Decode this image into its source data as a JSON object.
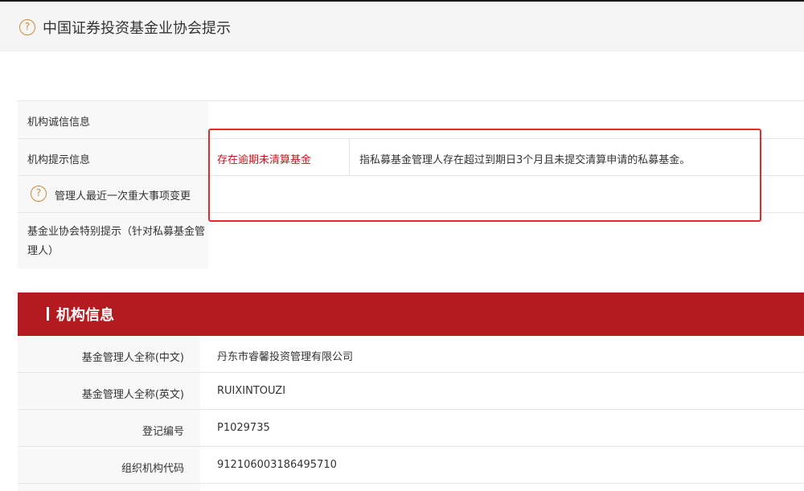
{
  "header": {
    "title": "中国证券投资基金业协会提示",
    "help_icon_glyph": "?"
  },
  "notice": {
    "rows": [
      {
        "label": "机构诚信信息"
      },
      {
        "label": "机构提示信息",
        "tag": "存在逾期未清算基金",
        "description": "指私募基金管理人存在超过到期日3个月且未提交清算申请的私募基金。"
      },
      {
        "label": "管理人最近一次重大事项变更"
      },
      {
        "label": "基金业协会特别提示（针对私募基金管理人）"
      }
    ],
    "colors": {
      "tag": "#c4161c",
      "highlight_box": "#e8292c"
    }
  },
  "section": {
    "title": "机构信息",
    "color": "#b31b21"
  },
  "info": {
    "rows": [
      {
        "label": "基金管理人全称(中文)",
        "value": "丹东市睿馨投资管理有限公司"
      },
      {
        "label": "基金管理人全称(英文)",
        "value": "RUIXINTOUZI"
      },
      {
        "label": "登记编号",
        "value": "P1029735"
      },
      {
        "label": "组织机构代码",
        "value": "912106003186495710"
      }
    ]
  }
}
